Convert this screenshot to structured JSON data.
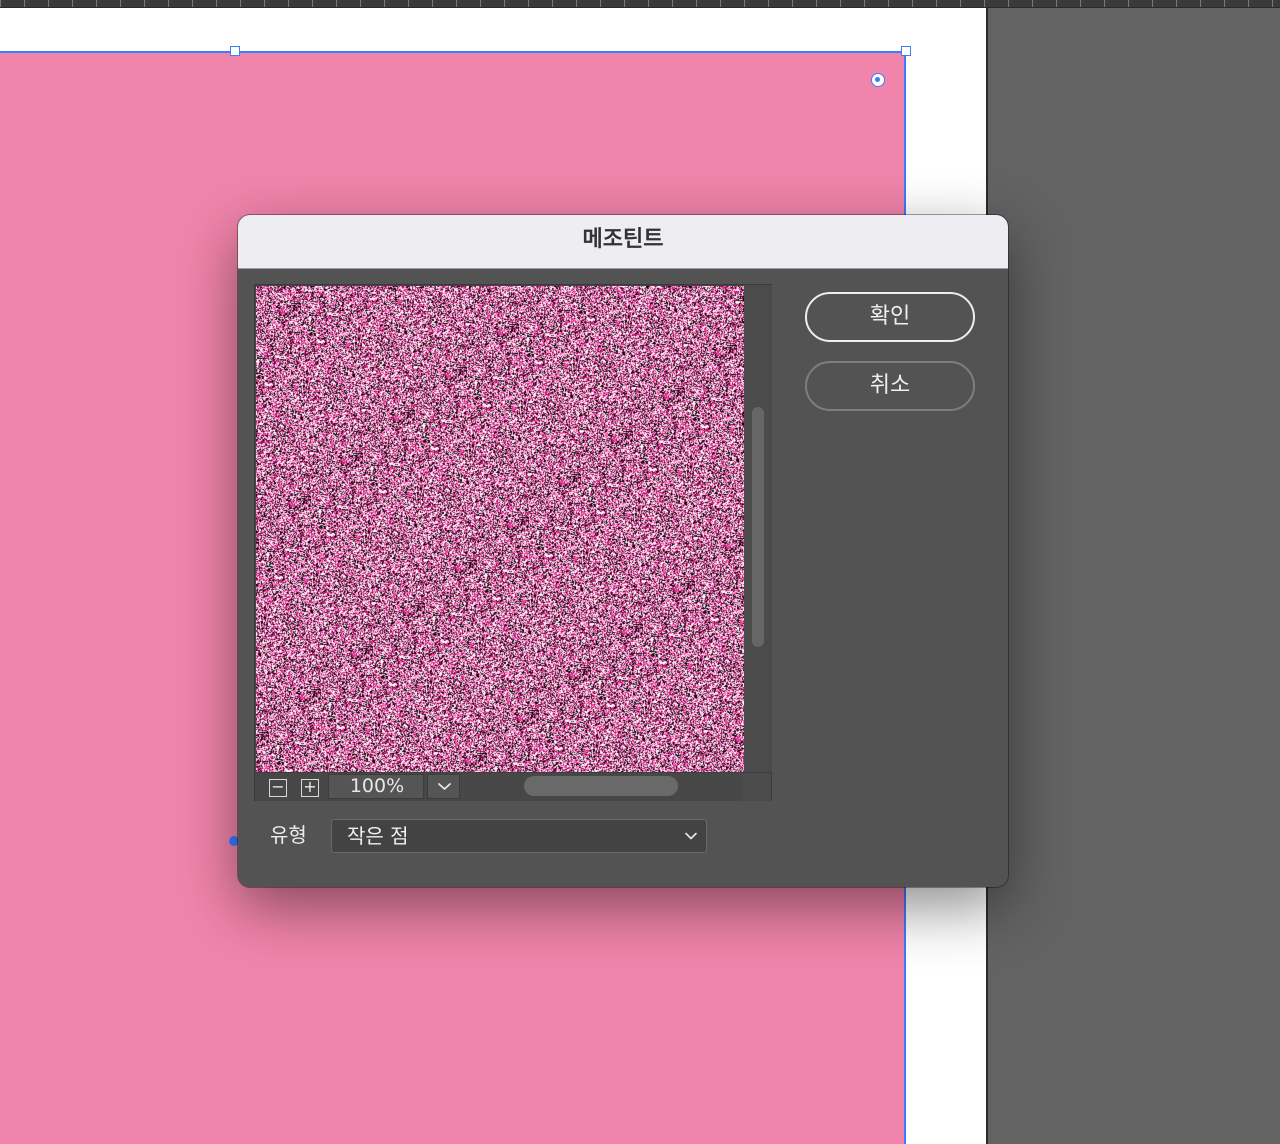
{
  "dialog": {
    "title": "메조틴트",
    "ok_label": "확인",
    "cancel_label": "취소"
  },
  "preview": {
    "zoom_value": "100%",
    "zoom_out_glyph": "−",
    "zoom_in_glyph": "+",
    "noise_colors": [
      "#ffffff",
      "#000000",
      "#ff3fb0",
      "#c81e78",
      "#f7a6d6",
      "#7a1040"
    ]
  },
  "type_field": {
    "label": "유형",
    "selected_value": "작은 점"
  },
  "colors": {
    "frame_fill": "#f184aa",
    "selection": "#3d7bff",
    "dialog_bg": "#535353",
    "titlebar_bg": "#eeedf2"
  },
  "icons": {
    "zoom_dropdown": "chevron-down-icon",
    "type_dropdown": "chevron-down-icon"
  }
}
